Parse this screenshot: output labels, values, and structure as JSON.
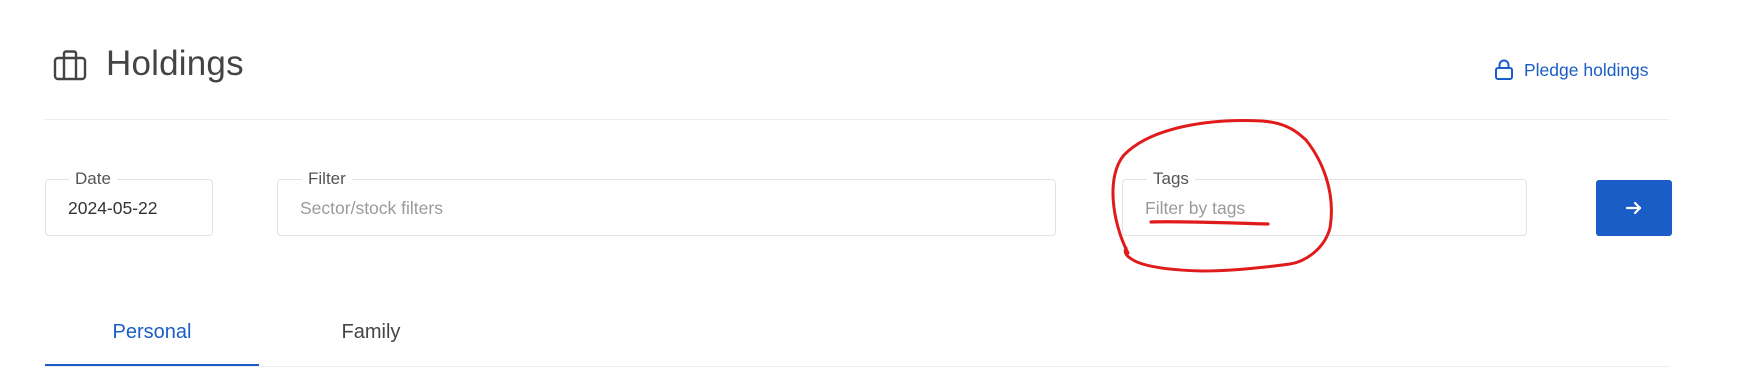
{
  "header": {
    "title": "Holdings",
    "title_icon": "briefcase-icon",
    "pledge_label": "Pledge holdings",
    "pledge_icon": "lock-icon"
  },
  "filters": {
    "date": {
      "label": "Date",
      "value": "2024-05-22"
    },
    "filter": {
      "label": "Filter",
      "placeholder": "Sector/stock filters"
    },
    "tags": {
      "label": "Tags",
      "placeholder": "Filter by tags"
    },
    "submit_icon": "arrow-right-icon"
  },
  "tabs": [
    {
      "label": "Personal",
      "active": true
    },
    {
      "label": "Family",
      "active": false
    }
  ],
  "colors": {
    "accent": "#1a5dc6",
    "annotation": "#e01b1b",
    "text": "#444444",
    "border": "#e3e3e3"
  }
}
